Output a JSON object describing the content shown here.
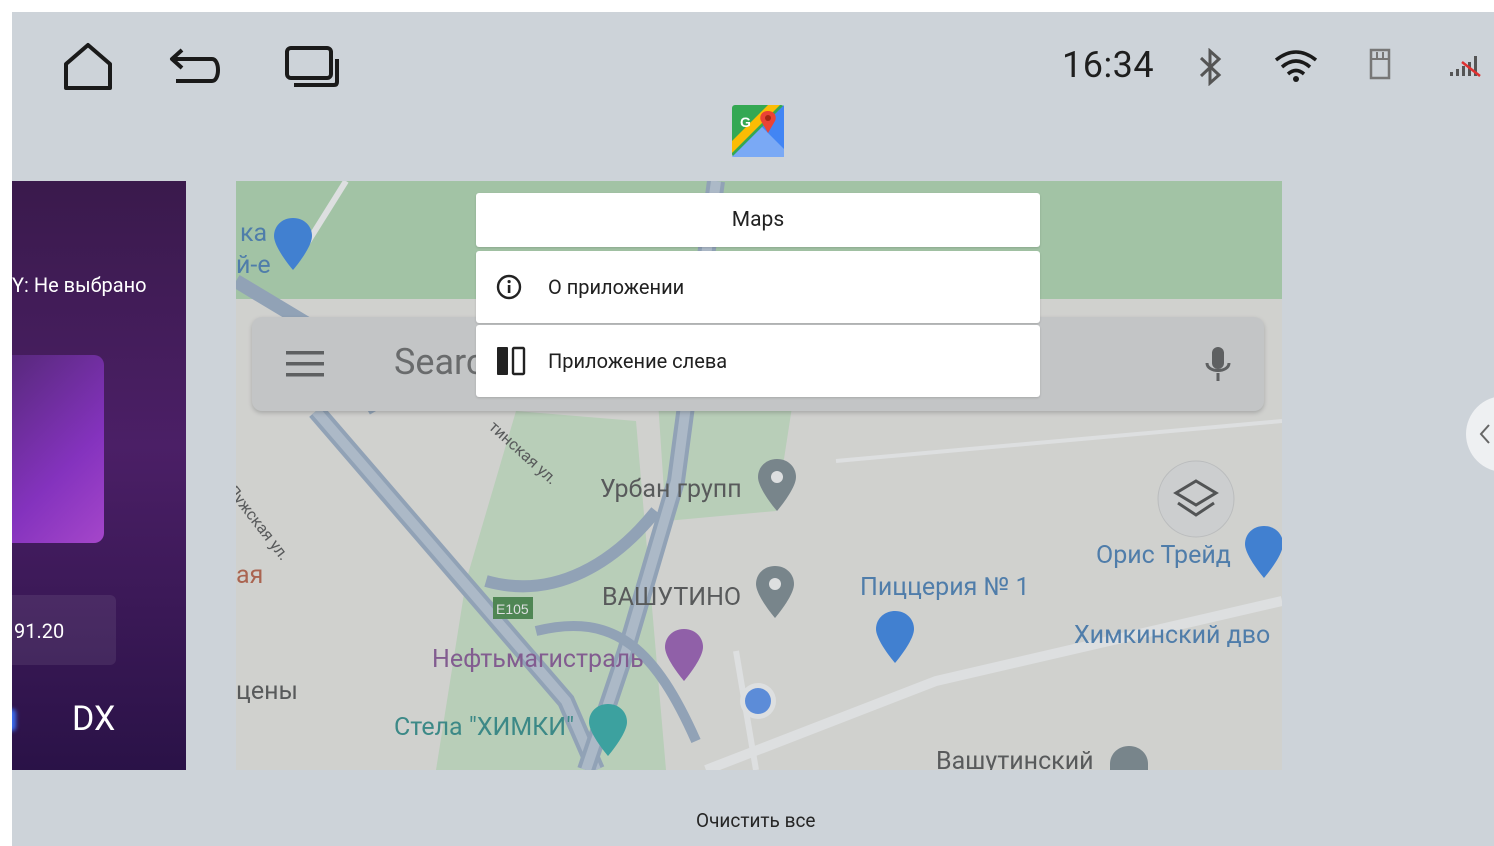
{
  "status_bar": {
    "time": "16:34",
    "nav": [
      {
        "name": "home",
        "icon": "home-icon"
      },
      {
        "name": "back",
        "icon": "back-icon"
      },
      {
        "name": "recents",
        "icon": "recents-icon"
      }
    ],
    "indicators": [
      "bluetooth-icon",
      "wifi-icon",
      "sd-card-icon",
      "cellular-signal-icon"
    ]
  },
  "recents": {
    "focused_app": {
      "title": "Maps",
      "icon": "google-maps-icon"
    },
    "left_card": {
      "source_line": "Y: Не выбрано",
      "frequency": "91.20",
      "band": "DX"
    },
    "map_card": {
      "search_placeholder": "Search",
      "labels": [
        "ка",
        "й-е",
        "Лужская ул.",
        "тинская ул.",
        "Урбан групп",
        "ВАШУТИНО",
        "Пиццерия № 1",
        "Орис Трейд",
        "Химкинский дво",
        "Нефтьмагистраль",
        "Стела \"ХИМКИ\"",
        "Вашутинский",
        "ая",
        "цены",
        "E105"
      ]
    }
  },
  "context_menu": {
    "title": "Maps",
    "items": [
      {
        "label": "О приложении",
        "icon": "info-icon"
      },
      {
        "label": "Приложение слева",
        "icon": "split-screen-icon"
      }
    ]
  },
  "footer": {
    "clear_all": "Очистить все"
  },
  "colors": {
    "background": "#cdd3d9",
    "radio_card": "#4b1f66",
    "menu_bg": "#ffffff"
  }
}
